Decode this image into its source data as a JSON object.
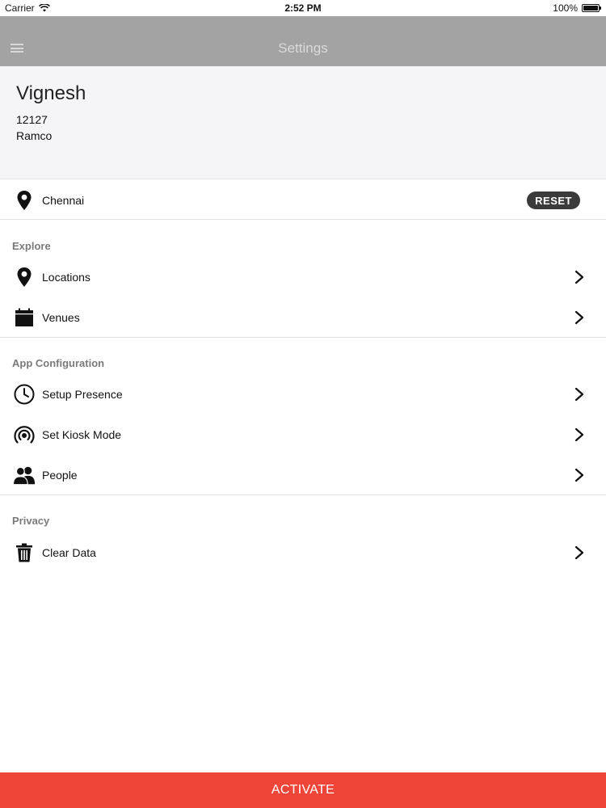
{
  "status_bar": {
    "carrier": "Carrier",
    "time": "2:52 PM",
    "battery": "100%"
  },
  "nav": {
    "title": "Settings"
  },
  "profile": {
    "name": "Vignesh",
    "id": "12127",
    "org": "Ramco"
  },
  "location": {
    "label": "Chennai",
    "reset_label": "RESET"
  },
  "explore": {
    "header": "Explore",
    "items": [
      {
        "label": "Locations",
        "icon": "map-pin-icon"
      },
      {
        "label": "Venues",
        "icon": "calendar-icon"
      }
    ]
  },
  "app_config": {
    "header": "App Configuration",
    "items": [
      {
        "label": "Setup Presence",
        "icon": "clock-icon"
      },
      {
        "label": "Set Kiosk Mode",
        "icon": "broadcast-icon"
      },
      {
        "label": "People",
        "icon": "people-icon"
      }
    ]
  },
  "privacy": {
    "header": "Privacy",
    "items": [
      {
        "label": "Clear Data",
        "icon": "trash-icon"
      }
    ]
  },
  "footer": {
    "activate_label": "ACTIVATE"
  },
  "colors": {
    "nav_bg": "#a3a3a3",
    "accent_red": "#ee4538",
    "profile_bg": "#f5f5f7",
    "reset_bg": "#3b3b3b"
  }
}
